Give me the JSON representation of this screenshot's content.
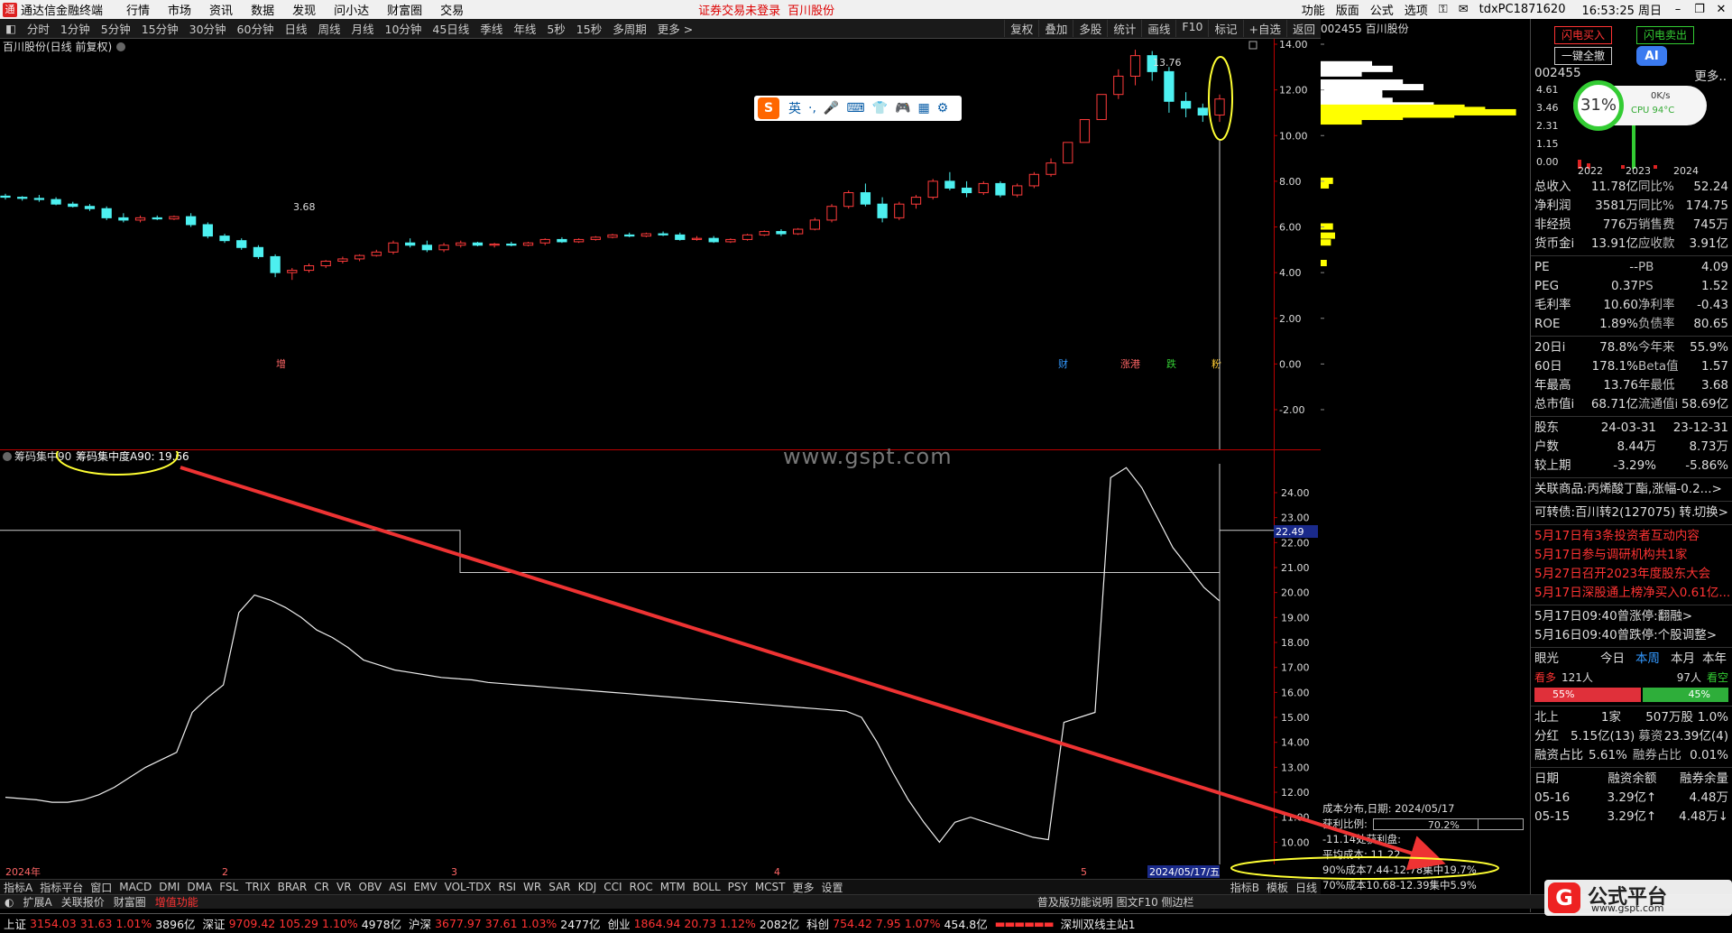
{
  "menu": {
    "app_title": "通达信金融终端",
    "items": [
      "行情",
      "市场",
      "资讯",
      "数据",
      "发现",
      "问小达",
      "财富圈",
      "交易"
    ],
    "warning": "证券交易未登录",
    "stock_name": "百川股份",
    "right_items": [
      "功能",
      "版面",
      "公式",
      "选项"
    ],
    "user": "tdxPC1871620",
    "clock": "16:53:25 周日"
  },
  "periods": [
    "分时",
    "1分钟",
    "5分钟",
    "15分钟",
    "30分钟",
    "60分钟",
    "日线",
    "周线",
    "月线",
    "10分钟",
    "45日线",
    "季线",
    "年线",
    "5秒",
    "15秒",
    "多周期",
    "更多 >"
  ],
  "chart_tools": [
    "复权",
    "叠加",
    "多股",
    "统计",
    "画线",
    "F10",
    "标记",
    "+自选",
    "返回"
  ],
  "main": {
    "title": "百川股份(日线 前复权)",
    "high_label": "13.76",
    "low_label": "3.68",
    "event_marks": [
      "增",
      "财",
      "涨港",
      "跌",
      "粉"
    ]
  },
  "indicator": {
    "name": "筹码集中90",
    "value_label": "筹码集中度A90: 19.66",
    "current_tag": "22.49"
  },
  "watermark": "www.gspt.com",
  "ime": {
    "label": "英",
    "items": [
      "·,",
      "🎤",
      "⌨",
      "👕",
      "🎮",
      "▦",
      "⚙"
    ]
  },
  "x_axis": {
    "year_label": "2024年",
    "months": [
      "2",
      "3",
      "4",
      "5"
    ],
    "cursor_date": "2024/05/17/五"
  },
  "chart_data": [
    {
      "type": "candlestick",
      "title": "百川股份(日线 前复权)",
      "ylim": [
        -2,
        14
      ],
      "yticks": [
        "14.00",
        "12.00",
        "10.00",
        "8.00",
        "6.00",
        "4.00",
        "2.00",
        "0.00",
        "-2.00"
      ],
      "ohlc": [
        [
          7.35,
          7.45,
          7.2,
          7.3
        ],
        [
          7.3,
          7.35,
          7.15,
          7.25
        ],
        [
          7.25,
          7.4,
          7.1,
          7.2
        ],
        [
          7.2,
          7.3,
          6.95,
          7.0
        ],
        [
          7.0,
          7.1,
          6.85,
          6.9
        ],
        [
          6.9,
          7.0,
          6.7,
          6.8
        ],
        [
          6.8,
          6.9,
          6.3,
          6.4
        ],
        [
          6.4,
          6.6,
          6.2,
          6.3
        ],
        [
          6.3,
          6.5,
          6.2,
          6.4
        ],
        [
          6.4,
          6.5,
          6.3,
          6.35
        ],
        [
          6.35,
          6.5,
          6.3,
          6.45
        ],
        [
          6.45,
          6.6,
          6.0,
          6.1
        ],
        [
          6.1,
          6.2,
          5.5,
          5.6
        ],
        [
          5.6,
          5.7,
          5.3,
          5.4
        ],
        [
          5.4,
          5.5,
          5.0,
          5.1
        ],
        [
          5.1,
          5.2,
          4.6,
          4.7
        ],
        [
          4.7,
          4.8,
          3.8,
          4.0
        ],
        [
          4.0,
          4.2,
          3.68,
          4.1
        ],
        [
          4.1,
          4.4,
          4.0,
          4.3
        ],
        [
          4.3,
          4.55,
          4.2,
          4.5
        ],
        [
          4.5,
          4.7,
          4.4,
          4.6
        ],
        [
          4.6,
          4.8,
          4.5,
          4.75
        ],
        [
          4.75,
          5.0,
          4.7,
          4.9
        ],
        [
          4.9,
          5.4,
          4.8,
          5.3
        ],
        [
          5.3,
          5.5,
          5.1,
          5.2
        ],
        [
          5.2,
          5.4,
          4.9,
          5.0
        ],
        [
          5.0,
          5.3,
          4.9,
          5.2
        ],
        [
          5.2,
          5.4,
          5.1,
          5.3
        ],
        [
          5.3,
          5.35,
          5.15,
          5.2
        ],
        [
          5.2,
          5.3,
          5.1,
          5.25
        ],
        [
          5.25,
          5.35,
          5.15,
          5.2
        ],
        [
          5.2,
          5.35,
          5.15,
          5.3
        ],
        [
          5.3,
          5.5,
          5.2,
          5.45
        ],
        [
          5.45,
          5.55,
          5.3,
          5.35
        ],
        [
          5.35,
          5.5,
          5.3,
          5.45
        ],
        [
          5.45,
          5.6,
          5.4,
          5.55
        ],
        [
          5.55,
          5.7,
          5.5,
          5.65
        ],
        [
          5.65,
          5.75,
          5.55,
          5.6
        ],
        [
          5.6,
          5.75,
          5.55,
          5.7
        ],
        [
          5.7,
          5.8,
          5.6,
          5.65
        ],
        [
          5.65,
          5.75,
          5.4,
          5.45
        ],
        [
          5.45,
          5.6,
          5.4,
          5.5
        ],
        [
          5.5,
          5.6,
          5.3,
          5.35
        ],
        [
          5.35,
          5.5,
          5.3,
          5.45
        ],
        [
          5.45,
          5.7,
          5.4,
          5.65
        ],
        [
          5.65,
          5.85,
          5.6,
          5.8
        ],
        [
          5.8,
          5.9,
          5.6,
          5.7
        ],
        [
          5.7,
          5.95,
          5.65,
          5.9
        ],
        [
          5.9,
          6.4,
          5.85,
          6.3
        ],
        [
          6.3,
          7.0,
          6.2,
          6.9
        ],
        [
          6.9,
          7.6,
          6.8,
          7.5
        ],
        [
          7.5,
          7.9,
          6.9,
          7.0
        ],
        [
          7.0,
          7.3,
          6.2,
          6.4
        ],
        [
          6.4,
          7.1,
          6.3,
          7.0
        ],
        [
          7.0,
          7.4,
          6.8,
          7.3
        ],
        [
          7.3,
          8.1,
          7.2,
          8.0
        ],
        [
          8.0,
          8.4,
          7.6,
          7.7
        ],
        [
          7.7,
          8.0,
          7.3,
          7.5
        ],
        [
          7.5,
          8.0,
          7.4,
          7.9
        ],
        [
          7.9,
          8.0,
          7.3,
          7.4
        ],
        [
          7.4,
          7.9,
          7.3,
          7.8
        ],
        [
          7.8,
          8.4,
          7.7,
          8.3
        ],
        [
          8.3,
          9.0,
          8.2,
          8.8
        ],
        [
          8.8,
          9.7,
          8.8,
          9.7
        ],
        [
          9.7,
          10.7,
          9.7,
          10.7
        ],
        [
          10.7,
          11.8,
          10.7,
          11.8
        ],
        [
          11.8,
          12.9,
          11.6,
          12.6
        ],
        [
          12.6,
          13.76,
          12.2,
          13.5
        ],
        [
          13.5,
          13.7,
          12.4,
          12.8
        ],
        [
          12.8,
          13.0,
          11.0,
          11.5
        ],
        [
          11.5,
          11.9,
          10.8,
          11.2
        ],
        [
          11.2,
          11.4,
          10.6,
          10.9
        ],
        [
          10.9,
          11.8,
          10.6,
          11.6
        ]
      ]
    },
    {
      "type": "line",
      "name": "筹码集中度A90",
      "ylim": [
        9.4,
        25.3
      ],
      "yticks": [
        "24.00",
        "23.00",
        "22.00",
        "21.00",
        "20.00",
        "19.00",
        "18.00",
        "17.00",
        "16.00",
        "15.00",
        "14.00",
        "13.00",
        "12.00",
        "11.00",
        "10.00"
      ],
      "values": [
        11.8,
        11.75,
        11.7,
        11.6,
        11.6,
        11.7,
        11.9,
        12.2,
        12.6,
        13.0,
        13.3,
        13.6,
        15.2,
        15.8,
        16.3,
        19.2,
        19.9,
        19.7,
        19.4,
        19.0,
        18.5,
        18.2,
        17.8,
        17.3,
        17.1,
        16.9,
        16.8,
        16.7,
        16.6,
        16.55,
        16.5,
        16.4,
        16.35,
        16.3,
        16.25,
        16.2,
        16.15,
        16.1,
        16.05,
        16.0,
        15.95,
        15.9,
        15.85,
        15.8,
        15.75,
        15.7,
        15.65,
        15.6,
        15.55,
        15.5,
        15.45,
        15.4,
        15.35,
        15.3,
        15.25,
        15.0,
        14.0,
        12.8,
        11.7,
        10.8,
        10.0,
        10.8,
        11.0,
        10.8,
        10.6,
        10.4,
        10.2,
        10.1,
        14.8,
        15.0,
        15.2,
        24.6,
        25.0,
        24.2,
        23.0,
        21.8,
        21.0,
        20.2,
        19.66
      ],
      "step_line": {
        "levels": [
          22.49,
          20.8
        ],
        "break_month": "3"
      }
    }
  ],
  "profile": {
    "cost_title": "成本分布,日期: 2024/05/17",
    "profit_label": "获利比例:",
    "profit_value": "70.2%",
    "profit_fraction": 0.702,
    "line2": "-11.14处获利盘:",
    "avg_cost": "平均成本: 11.22",
    "c90": "90%成本7.44-12.78集中19.7%",
    "c70": "70%成本10.68-12.39集中5.9%",
    "price_ticks": [
      "14.00",
      "12.00",
      "10.00",
      "8.00",
      "6.00",
      "4.00",
      "2.00",
      "0.00",
      "-2.00"
    ],
    "bars": [
      [
        13.1,
        0.25
      ],
      [
        12.9,
        0.35
      ],
      [
        12.7,
        0.2
      ],
      [
        12.3,
        0.4
      ],
      [
        12.1,
        0.5
      ],
      [
        11.9,
        0.3
      ],
      [
        11.7,
        0.3
      ],
      [
        11.5,
        0.35
      ],
      [
        11.3,
        0.55
      ],
      [
        11.2,
        0.7
      ],
      [
        11.1,
        0.8
      ],
      [
        11.0,
        0.95
      ],
      [
        10.9,
        0.65
      ],
      [
        10.8,
        0.4
      ],
      [
        10.6,
        0.2
      ],
      [
        8.0,
        0.06
      ],
      [
        7.8,
        0.04
      ],
      [
        6.0,
        0.06
      ],
      [
        5.6,
        0.07
      ],
      [
        5.3,
        0.05
      ],
      [
        4.4,
        0.03
      ]
    ]
  },
  "tabs": {
    "indicators": [
      "指标A",
      "指标平台",
      "窗口",
      "MACD",
      "DMI",
      "DMA",
      "FSL",
      "TRIX",
      "BRAR",
      "CR",
      "VR",
      "OBV",
      "ASI",
      "EMV",
      "VOL-TDX",
      "RSI",
      "WR",
      "SAR",
      "KDJ",
      "CCI",
      "ROC",
      "MTM",
      "BOLL",
      "PSY",
      "MCST",
      "更多",
      "设置"
    ],
    "bottom": [
      "扩展A",
      "关联报价",
      "财富圈",
      "增值功能"
    ],
    "right_bottom": [
      "指标B",
      "模板",
      "日线"
    ],
    "hint": "普及版功能说明 图文F10 侧边栏"
  },
  "status": {
    "items": [
      {
        "name": "上证",
        "price": "3154.03",
        "chg": "31.63",
        "pct": "1.01%",
        "amt": "3896亿"
      },
      {
        "name": "深证",
        "price": "9709.42",
        "chg": "105.29",
        "pct": "1.10%",
        "amt": "4978亿"
      },
      {
        "name": "沪深",
        "price": "3677.97",
        "chg": "37.61",
        "pct": "1.03%",
        "amt": "2477亿"
      },
      {
        "name": "创业",
        "price": "1864.94",
        "chg": "20.73",
        "pct": "1.12%",
        "amt": "2082亿"
      },
      {
        "name": "科创",
        "price": "754.42",
        "chg": "7.95",
        "pct": "1.07%",
        "amt": "454.8亿"
      }
    ],
    "server": "深圳双线主站1"
  },
  "rp": {
    "code_title": "002455 百川股份",
    "btn_buy": "闪电买入",
    "btn_sell": "闪电卖出",
    "btn_all": "一键全撤",
    "more": "更多..",
    "code": "002455",
    "rev_chart": {
      "type": "bar",
      "yticks": [
        "4.61",
        "3.46",
        "2.31",
        "1.15",
        "0.00"
      ],
      "years": [
        "2022",
        "2023",
        "2024"
      ]
    },
    "fin": [
      [
        "总收入",
        "11.78亿",
        "同比%",
        "52.24"
      ],
      [
        "净利润",
        "3581万",
        "同比%",
        "174.75"
      ],
      [
        "非经损",
        "776万",
        "销售费",
        "745万"
      ],
      [
        "货币金i",
        "13.91亿",
        "应收款",
        "3.91亿"
      ]
    ],
    "ratios": [
      [
        "PE",
        "--",
        "PB",
        "4.09"
      ],
      [
        "PEG",
        "0.37",
        "PS",
        "1.52"
      ],
      [
        "毛利率",
        "10.60",
        "净利率",
        "-0.43"
      ],
      [
        "ROE",
        "1.89%",
        "负债率",
        "80.65"
      ]
    ],
    "perf": [
      [
        "20日i",
        "78.8%",
        "今年来",
        "55.9%"
      ],
      [
        "60日",
        "178.1%",
        "Beta值",
        "1.57"
      ],
      [
        "年最高",
        "13.76",
        "年最低",
        "3.68"
      ],
      [
        "总市值i",
        "68.71亿",
        "流通值i",
        "58.69亿"
      ]
    ],
    "holders": [
      [
        "股东",
        "24-03-31",
        "23-12-31"
      ],
      [
        "户数",
        "8.44万",
        "8.73万"
      ],
      [
        "较上期",
        "-3.29%",
        "-5.86%"
      ]
    ],
    "related": "关联商品:丙烯酸丁酯,涨幅-0.2...>",
    "bond": "可转债:百川转2(127075) 转...",
    "bond_switch": "切换>",
    "news": [
      "5月17日有3条投资者互动内容",
      "5月17日参与调研机构共1家",
      "5月27日召开2023年度股东大会",
      "5月17日深股通上榜净买入0.61亿..."
    ],
    "alerts": [
      "5月17日09:40曾涨停:翻融>",
      "5月16日09:40曾跌停:个股调整>"
    ],
    "yanguang": {
      "label": "眼光",
      "tabs": [
        "今日",
        "本周",
        "本月",
        "本年"
      ],
      "bull": "看多",
      "bull_n": "121人",
      "bear_n": "97人",
      "bear": "看空",
      "bull_pct": "55%",
      "bear_pct": "45%",
      "bull_frac": 0.55
    },
    "north": [
      "北上",
      "1家",
      "507万股",
      "1.0%"
    ],
    "dividend": [
      "分红",
      "5.15亿(13)",
      "募资",
      "23.39亿(4)"
    ],
    "margin": [
      "融资占比",
      "5.61%",
      "融券占比",
      "0.01%"
    ],
    "margin_table": {
      "head": [
        "日期",
        "融资余额",
        "融券余量"
      ],
      "rows": [
        [
          "05-16",
          "3.29亿↑",
          "4.48万"
        ],
        [
          "05-15",
          "3.29亿↑",
          "4.48万↓"
        ]
      ]
    },
    "cpu": {
      "pct": "31%",
      "net": "0K/s",
      "temp": "CPU 94°C"
    },
    "brand": "公式平台",
    "brand_url": "www.gspt.com"
  }
}
